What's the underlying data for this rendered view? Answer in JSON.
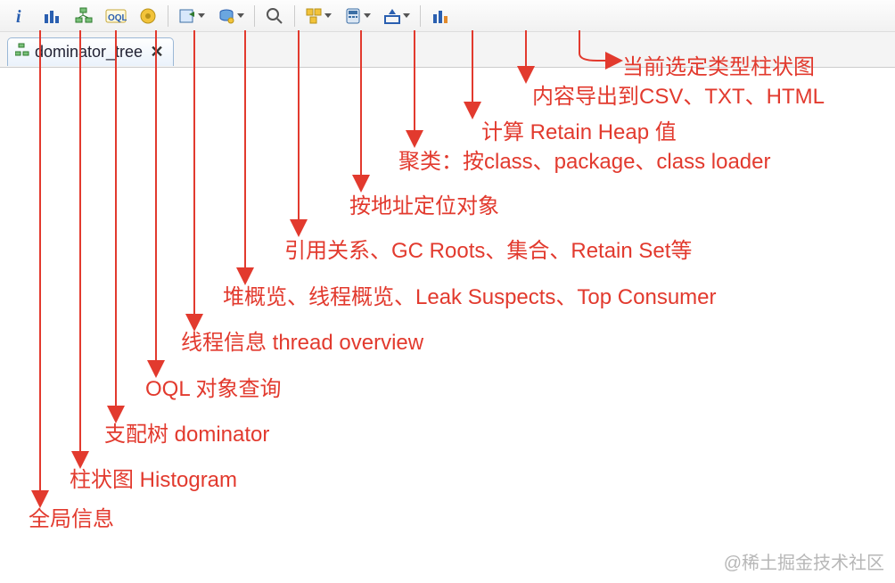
{
  "toolbar": {
    "items": [
      {
        "name": "overview-icon",
        "drop": false
      },
      {
        "name": "histogram-icon",
        "drop": false
      },
      {
        "name": "dominator-tree-icon",
        "drop": false
      },
      {
        "name": "oql-icon",
        "drop": false
      },
      {
        "name": "thread-overview-icon",
        "drop": false
      },
      {
        "sep": true
      },
      {
        "name": "heap-overview-icon",
        "drop": true
      },
      {
        "name": "query-browser-icon",
        "drop": true
      },
      {
        "sep": true
      },
      {
        "name": "find-object-icon",
        "drop": false
      },
      {
        "sep": true
      },
      {
        "name": "group-by-icon",
        "drop": true
      },
      {
        "name": "calculate-retained-icon",
        "drop": true
      },
      {
        "name": "export-icon",
        "drop": true
      },
      {
        "sep": true
      },
      {
        "name": "chart-selection-icon",
        "drop": false
      }
    ]
  },
  "tab": {
    "label": "dominator_tree",
    "close": "✕"
  },
  "annotations": {
    "a0": "全局信息",
    "a1": "柱状图 Histogram",
    "a2": "支配树 dominator",
    "a3": "OQL 对象查询",
    "a4": "线程信息 thread overview",
    "a5": "堆概览、线程概览、Leak Suspects、Top Consumer",
    "a6": "引用关系、GC Roots、集合、Retain Set等",
    "a7": "按地址定位对象",
    "a8": "聚类：按class、package、class loader",
    "a9": "计算 Retain Heap 值",
    "a10": "内容导出到CSV、TXT、HTML",
    "a11": "当前选定类型柱状图"
  },
  "watermark": "@稀土掘金技术社区"
}
